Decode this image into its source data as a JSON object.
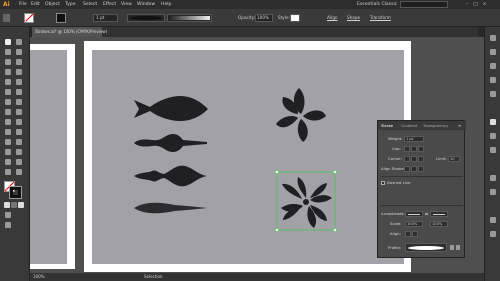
{
  "menubar": {
    "logo": "Ai",
    "items": [
      "File",
      "Edit",
      "Object",
      "Type",
      "Select",
      "Effect",
      "View",
      "Window",
      "Help"
    ],
    "workspace": "Essentials Classic",
    "search_placeholder": "Search Adobe Stock"
  },
  "control_bar": {
    "stroke_weight": "1 pt",
    "opacity_label": "Opacity:",
    "opacity_value": "100%",
    "style_label": "Style:",
    "align_label": "Align",
    "shape_label": "Shape",
    "transform_label": "Transform"
  },
  "document_tab": {
    "title": "Strokes.ai* @ 100% (CMYK/Preview)"
  },
  "status_bar": {
    "zoom": "100%",
    "tool": "Selection"
  },
  "stroke_panel": {
    "tabs": [
      "Stroke",
      "Gradient",
      "Transparency"
    ],
    "weight_label": "Weight:",
    "weight_value": "1 pt",
    "cap_label": "Cap:",
    "corner_label": "Corner:",
    "limit_label": "Limit:",
    "limit_value": "10",
    "align_stroke_label": "Align Stroke:",
    "dashed_line_label": "Dashed Line",
    "arrowheads_label": "Arrowheads:",
    "scale_label": "Scale:",
    "scale_values": [
      "100%",
      "100%"
    ],
    "align_label": "Align:",
    "profile_label": "Profile:"
  },
  "colors": {
    "ui_dark": "#282828",
    "panel": "#393939",
    "artboard": "#ffffff",
    "selection": "#4fc44f",
    "shape_fill": "#1f1f24",
    "gray_rect": "#a2a1a7"
  }
}
